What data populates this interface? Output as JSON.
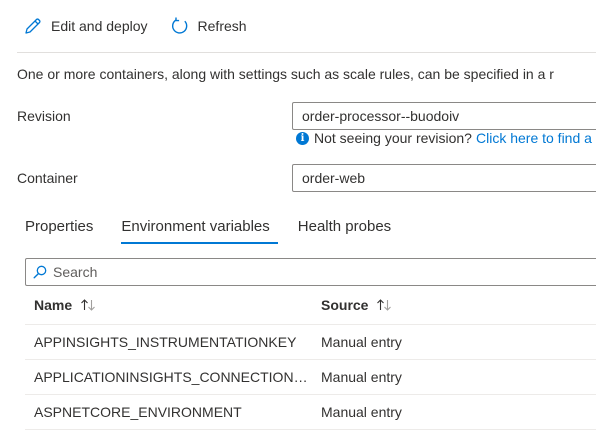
{
  "toolbar": {
    "edit_label": "Edit and deploy",
    "refresh_label": "Refresh"
  },
  "intro_text": "One or more containers, along with settings such as scale rules, can be specified in a r",
  "revision": {
    "label": "Revision",
    "value": "order-processor--buodoiv",
    "hint_text": "Not seeing your revision?",
    "hint_link": "Click here to find a"
  },
  "container": {
    "label": "Container",
    "value": "order-web"
  },
  "tabs": [
    {
      "label": "Properties",
      "active": false
    },
    {
      "label": "Environment variables",
      "active": true
    },
    {
      "label": "Health probes",
      "active": false
    }
  ],
  "search": {
    "placeholder": "Search"
  },
  "table": {
    "headers": [
      "Name",
      "Source"
    ],
    "rows": [
      {
        "name": "APPINSIGHTS_INSTRUMENTATIONKEY",
        "source": "Manual entry"
      },
      {
        "name": "APPLICATIONINSIGHTS_CONNECTION_ST...",
        "source": "Manual entry"
      },
      {
        "name": "ASPNETCORE_ENVIRONMENT",
        "source": "Manual entry"
      }
    ]
  },
  "colors": {
    "accent": "#0078d4",
    "text": "#323130",
    "border": "#8a8886"
  }
}
